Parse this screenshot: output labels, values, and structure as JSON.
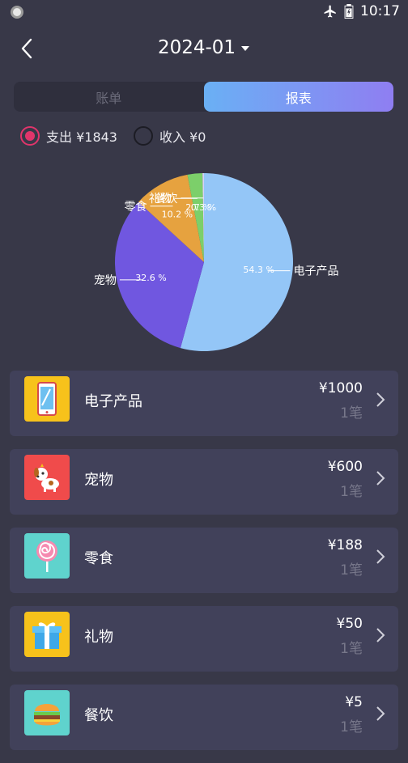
{
  "status": {
    "time": "10:17"
  },
  "header": {
    "month": "2024-01"
  },
  "tabs": {
    "bill": "账单",
    "report": "报表"
  },
  "filters": {
    "expense": "支出 ¥1843",
    "income": "收入 ¥0"
  },
  "chart_data": {
    "type": "pie",
    "slices": [
      {
        "label": "电子产品",
        "value": 1000,
        "percent_text": "54.3 %",
        "color": "#94c6f7"
      },
      {
        "label": "宠物",
        "value": 600,
        "percent_text": "32.6 %",
        "color": "#7057e0"
      },
      {
        "label": "零食",
        "value": 188,
        "percent_text": "10.2 %",
        "color": "#e6a23f"
      },
      {
        "label": "礼物",
        "value": 50,
        "percent_text": "2.7 %",
        "color": "#7ccf6a"
      },
      {
        "label": "餐饮",
        "value": 5,
        "percent_text": "0.3 %",
        "color": "#d9d1f6"
      }
    ]
  },
  "categories": [
    {
      "name": "电子产品",
      "amount": "¥1000",
      "count": "1笔",
      "icon": "tablet-icon",
      "bg": "#f7c21b"
    },
    {
      "name": "宠物",
      "amount": "¥600",
      "count": "1笔",
      "icon": "dog-icon",
      "bg": "#f04b4b"
    },
    {
      "name": "零食",
      "amount": "¥188",
      "count": "1笔",
      "icon": "lollipop-icon",
      "bg": "#5fd3cd"
    },
    {
      "name": "礼物",
      "amount": "¥50",
      "count": "1笔",
      "icon": "gift-icon",
      "bg": "#f7c21b"
    },
    {
      "name": "餐饮",
      "amount": "¥5",
      "count": "1笔",
      "icon": "burger-icon",
      "bg": "#5fd3cd"
    }
  ]
}
